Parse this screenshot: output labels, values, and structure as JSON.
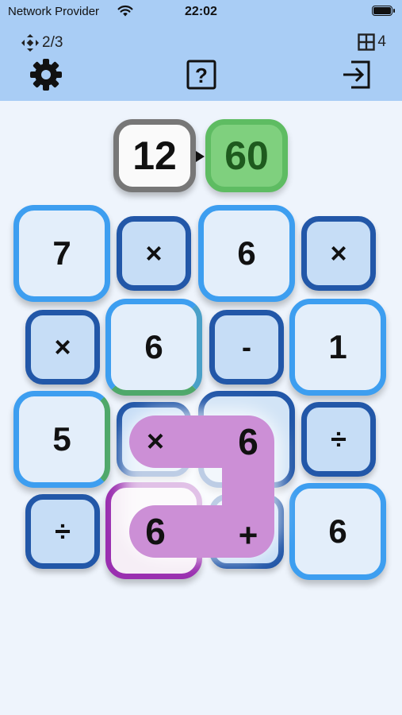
{
  "status_bar": {
    "carrier": "Network Provider",
    "time": "22:02"
  },
  "toolbar": {
    "level_progress": "2/3",
    "grid_size": "4",
    "settings_icon": "gear-icon",
    "help_icon": "question-box-icon",
    "exit_icon": "exit-icon"
  },
  "target": {
    "current": "12",
    "goal": "60"
  },
  "board": {
    "tiles": [
      {
        "id": "r1c1",
        "kind": "number",
        "value": "7"
      },
      {
        "id": "r1c2",
        "kind": "operator",
        "value": "×"
      },
      {
        "id": "r1c3",
        "kind": "number",
        "value": "6"
      },
      {
        "id": "r1c4",
        "kind": "operator",
        "value": "×"
      },
      {
        "id": "r2c1",
        "kind": "operator",
        "value": "×"
      },
      {
        "id": "r2c2",
        "kind": "number",
        "value": "6"
      },
      {
        "id": "r2c3",
        "kind": "operator",
        "value": "-"
      },
      {
        "id": "r2c4",
        "kind": "number",
        "value": "1"
      },
      {
        "id": "r3c1",
        "kind": "number",
        "value": "5"
      },
      {
        "id": "r3c4",
        "kind": "operator",
        "value": "÷"
      },
      {
        "id": "r4c1",
        "kind": "operator",
        "value": "÷"
      },
      {
        "id": "r4c4",
        "kind": "number",
        "value": "6"
      }
    ],
    "selected_path": [
      {
        "id": "r3c2",
        "value": "×"
      },
      {
        "id": "r3c3",
        "value": "6"
      },
      {
        "id": "r4c3",
        "value": "+"
      },
      {
        "id": "r4c2",
        "value": "6"
      }
    ]
  },
  "colors": {
    "topbar": "#a9cdf5",
    "number_border": "#3d9ef0",
    "operator_border": "#2257a8",
    "goal_fill": "#7fd07e",
    "path_fill": "#cc8fd6",
    "selected_border": "#9a2fb0"
  }
}
